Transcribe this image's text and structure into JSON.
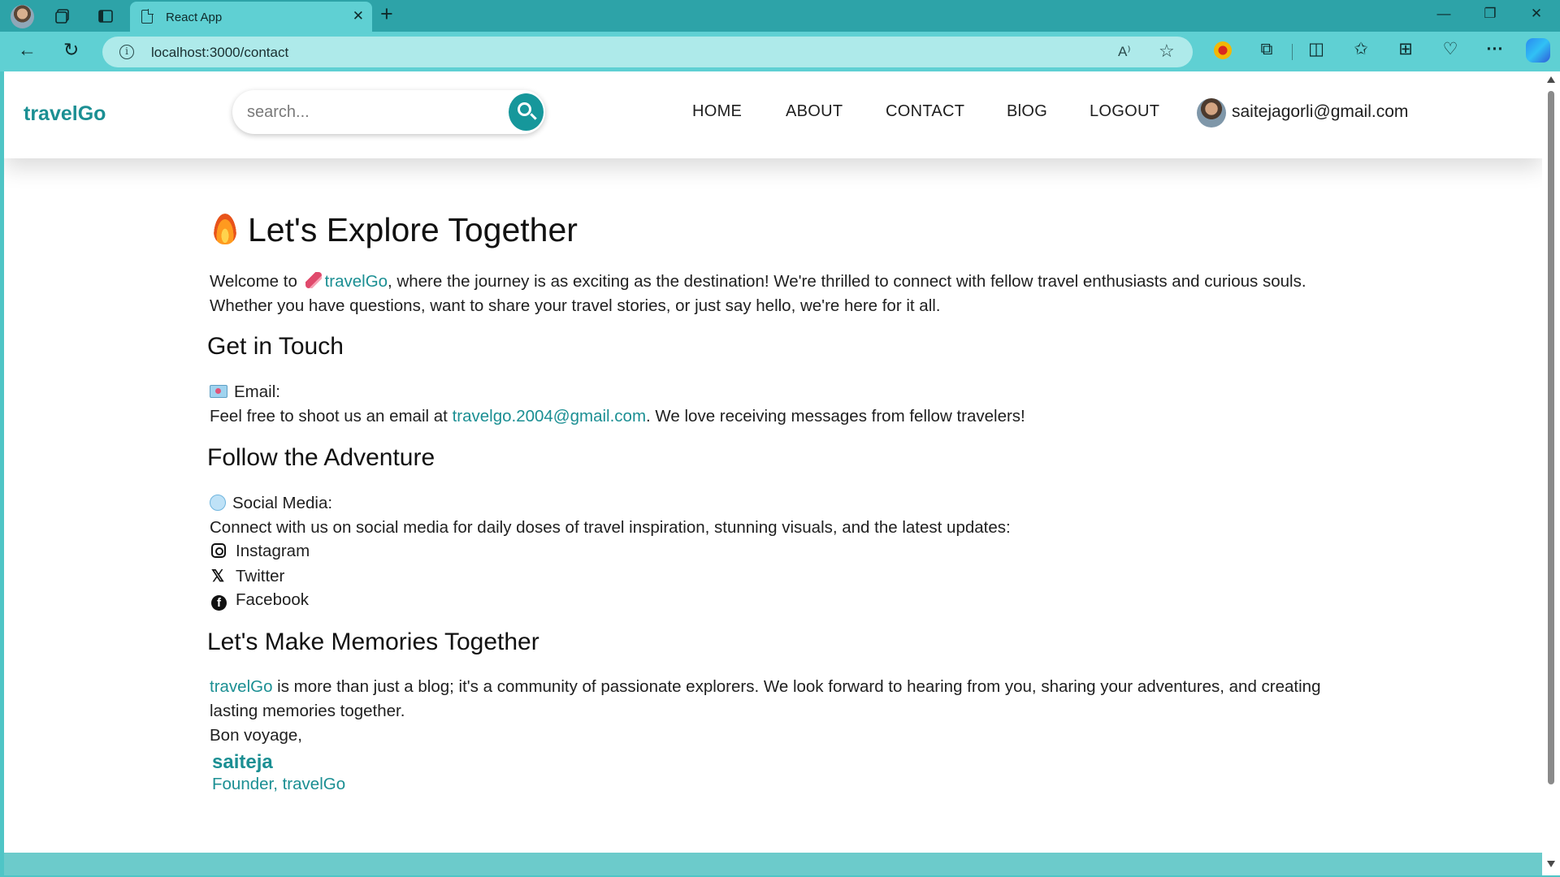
{
  "browser": {
    "tab_title": "React App",
    "tab_close": "✕",
    "new_tab": "+",
    "url": "localhost:3000/contact",
    "window_controls": {
      "minimize": "—",
      "restore": "❐",
      "close": "✕"
    },
    "nav": {
      "back": "←",
      "reload": "↻"
    },
    "address_icons": {
      "read_aloud": "A⁾",
      "favorite": "☆"
    },
    "toolbar_icons": {
      "extensions": "⧉",
      "split": "◫",
      "favorites": "✩",
      "collections": "⊞",
      "health": "♡",
      "more": "···"
    }
  },
  "site": {
    "brand": "travelGo",
    "search_placeholder": "search...",
    "nav_items": [
      "HOME",
      "ABOUT",
      "CONTACT",
      "BlOG",
      "LOGOUT"
    ],
    "user_email": "saitejagorli@gmail.com"
  },
  "content": {
    "title": "Let's Explore Together",
    "intro": {
      "pre": "Welcome to",
      "brand": "travelGo",
      "post": ", where the journey is as exciting as the destination! We're thrilled to connect with fellow travel enthusiasts and curious souls. Whether you have questions, want to share your travel stories, or just say hello, we're here for it all."
    },
    "get_in_touch": {
      "heading": "Get in Touch",
      "email_label": "Email:",
      "email_pre": "Feel free to shoot us an email at",
      "email": "travelgo.2004@gmail.com",
      "email_post": ". We love receiving messages from fellow travelers!"
    },
    "follow": {
      "heading": "Follow the Adventure",
      "social_label": "Social Media:",
      "social_text": "Connect with us on social media for daily doses of travel inspiration, stunning visuals, and the latest updates:",
      "links": [
        "Instagram",
        "Twitter",
        "Facebook"
      ]
    },
    "memories": {
      "heading": "Let's Make Memories Together",
      "brand": "travelGo",
      "text": " is more than just a blog; it's a community of passionate explorers. We look forward to hearing from you, sharing your adventures, and creating lasting memories together.",
      "closing": "Bon voyage,",
      "signature": "saiteja",
      "role": "Founder, travelGo"
    }
  },
  "colors": {
    "accent": "#1b8f93",
    "browser_frame": "#2da3a8",
    "toolbar": "#5fd0d3"
  }
}
